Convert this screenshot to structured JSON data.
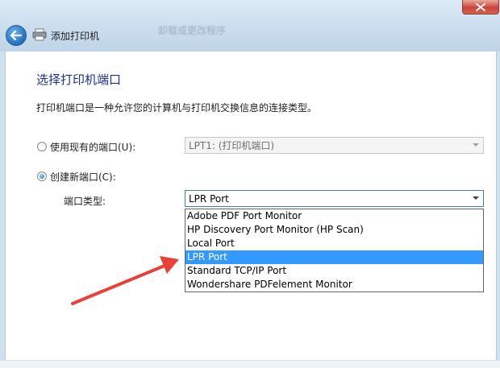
{
  "window": {
    "title": "添加打印机",
    "background_hint": "卸载或更改程序"
  },
  "wizard": {
    "heading": "选择打印机端口",
    "description": "打印机端口是一种允许您的计算机与打印机交换信息的连接类型。"
  },
  "existing_port": {
    "label": "使用现有的端口(U):",
    "selected": false,
    "value": "LPT1: (打印机端口)"
  },
  "new_port": {
    "label": "创建新端口(C):",
    "selected": true,
    "type_label": "端口类型:",
    "value": "LPR Port",
    "options": [
      "Adobe PDF Port Monitor",
      "HP Discovery Port Monitor (HP Scan)",
      "Local Port",
      "LPR Port",
      "Standard TCP/IP Port",
      "Wondershare PDFelement Monitor"
    ],
    "highlighted_index": 3
  },
  "colors": {
    "accent": "#3399ff",
    "heading": "#1e3287",
    "annotation_arrow": "#e8413a"
  },
  "icons": {
    "back": "back-arrow-icon",
    "printer": "printer-icon",
    "close": "close-icon"
  }
}
